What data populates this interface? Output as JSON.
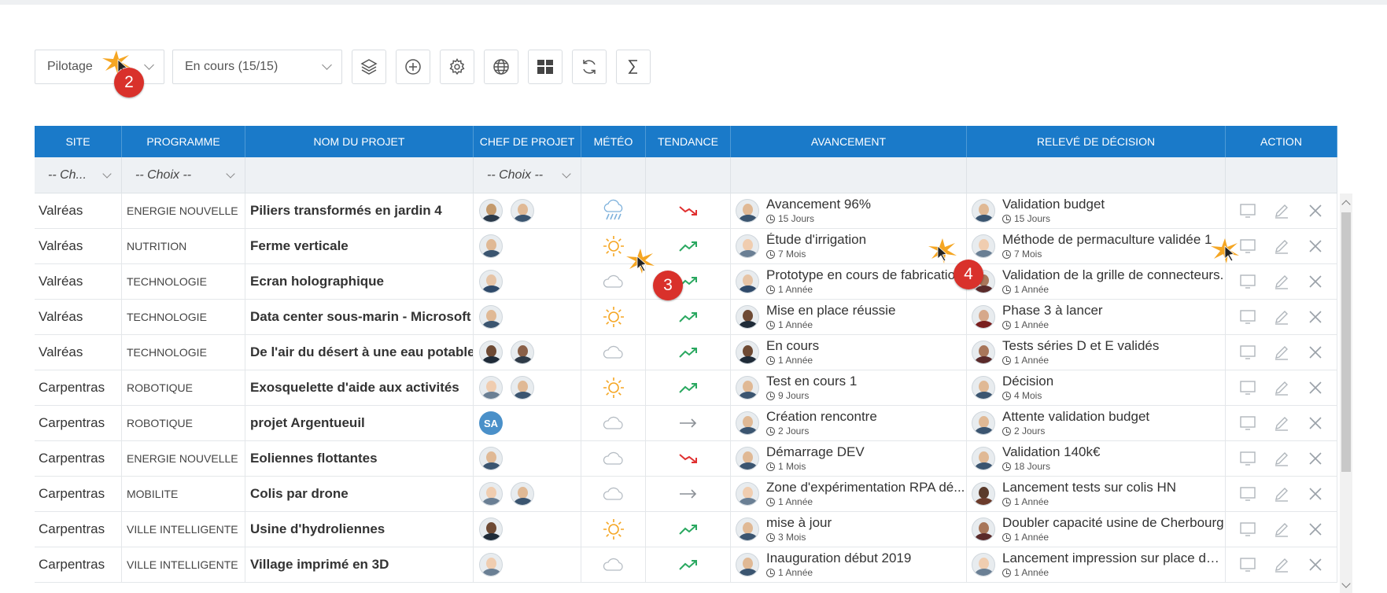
{
  "toolbar": {
    "view_select": "Pilotage",
    "status_select": "En cours (15/15)",
    "buttons": [
      "layers-icon",
      "add-icon",
      "settings-icon",
      "globe-icon",
      "dashboard-icon",
      "refresh-icon",
      "sum-icon"
    ]
  },
  "annotations": [
    "2",
    "3",
    "4"
  ],
  "columns": {
    "site": "SITE",
    "programme": "PROGRAMME",
    "nom": "NOM DU PROJET",
    "chef": "CHEF DE PROJET",
    "meteo": "MÉTÉO",
    "tendance": "TENDANCE",
    "avancement": "AVANCEMENT",
    "releve": "RELEVÉ DE DÉCISION",
    "action": "ACTION"
  },
  "filters": {
    "site": "-- Ch...",
    "programme": "-- Choix --",
    "chef": "-- Choix --"
  },
  "colors": {
    "header": "#1a7ac9",
    "badge": "#d9312b",
    "sun": "#f5a623",
    "up": "#2aa860",
    "down": "#e03030"
  },
  "rows": [
    {
      "site": "Valréas",
      "programme": "ENERGIE NOUVELLE",
      "nom": "Piliers transformés en jardin 4",
      "chefs": [
        "a",
        "b"
      ],
      "meteo": "rain",
      "tendance": "down",
      "av_text": "Avancement 96%",
      "av_date": "15 Jours",
      "av_av": "b",
      "rel_text": "Validation budget",
      "rel_date": "15 Jours",
      "rel_av": "b"
    },
    {
      "site": "Valréas",
      "programme": "NUTRITION",
      "nom": "Ferme verticale",
      "chefs": [
        "b"
      ],
      "meteo": "sun",
      "tendance": "up",
      "av_text": "Étude d'irrigation",
      "av_date": "7 Mois",
      "av_av": "c",
      "rel_text": "Méthode de permaculture validée 1",
      "rel_date": "7 Mois",
      "rel_av": "c"
    },
    {
      "site": "Valréas",
      "programme": "TECHNOLOGIE",
      "nom": "Ecran holographique",
      "chefs": [
        "d"
      ],
      "meteo": "cloud",
      "tendance": "up",
      "av_text": "Prototype en cours de fabrication",
      "av_date": "1 Année",
      "av_av": "d",
      "rel_text": "Validation de la grille de connecteurs.",
      "rel_date": "1 Année",
      "rel_av": "e"
    },
    {
      "site": "Valréas",
      "programme": "TECHNOLOGIE",
      "nom": "Data center sous-marin - Microsoft",
      "chefs": [
        "b"
      ],
      "meteo": "sun",
      "tendance": "up",
      "av_text": "Mise en place réussie",
      "av_date": "1 Année",
      "av_av": "f",
      "rel_text": "Phase 3 à lancer",
      "rel_date": "1 Année",
      "rel_av": "g"
    },
    {
      "site": "Valréas",
      "programme": "TECHNOLOGIE",
      "nom": "De l'air du désert à une eau potable",
      "chefs": [
        "f",
        "h"
      ],
      "meteo": "cloud",
      "tendance": "up",
      "av_text": "En cours",
      "av_date": "1 Année",
      "av_av": "f",
      "rel_text": "Tests séries D et E validés",
      "rel_date": "1 Année",
      "rel_av": "e"
    },
    {
      "site": "Carpentras",
      "programme": "ROBOTIQUE",
      "nom": "Exosquelette d'aide aux activités",
      "chefs": [
        "c",
        "b"
      ],
      "meteo": "sun",
      "tendance": "up",
      "av_text": "Test en cours 1",
      "av_date": "9 Jours",
      "av_av": "b",
      "rel_text": "Décision",
      "rel_date": "4 Mois",
      "rel_av": "b"
    },
    {
      "site": "Carpentras",
      "programme": "ROBOTIQUE",
      "nom": "projet Argentueuil",
      "chefs": [
        "SA"
      ],
      "meteo": "cloud",
      "tendance": "flat",
      "av_text": "Création rencontre",
      "av_date": "2 Jours",
      "av_av": "b",
      "rel_text": "Attente validation budget",
      "rel_date": "2 Jours",
      "rel_av": "b"
    },
    {
      "site": "Carpentras",
      "programme": "ENERGIE NOUVELLE",
      "nom": "Eoliennes flottantes",
      "chefs": [
        "b"
      ],
      "meteo": "cloud",
      "tendance": "down",
      "av_text": "Démarrage DEV",
      "av_date": "1 Mois",
      "av_av": "b",
      "rel_text": "Validation 140k€",
      "rel_date": "18 Jours",
      "rel_av": "b"
    },
    {
      "site": "Carpentras",
      "programme": "MOBILITE",
      "nom": "Colis par drone",
      "chefs": [
        "c",
        "b"
      ],
      "meteo": "cloud",
      "tendance": "flat",
      "av_text": "Zone d'expérimentation RPA dé...",
      "av_date": "1 Année",
      "av_av": "c",
      "rel_text": "Lancement tests sur colis HN",
      "rel_date": "1 Année",
      "rel_av": "i"
    },
    {
      "site": "Carpentras",
      "programme": "VILLE INTELLIGENTE",
      "nom": "Usine d'hydroliennes",
      "chefs": [
        "f"
      ],
      "meteo": "sun",
      "tendance": "up",
      "av_text": "mise à jour",
      "av_date": "3 Mois",
      "av_av": "b",
      "rel_text": "Doubler capacité usine de Cherbourg",
      "rel_date": "1 Année",
      "rel_av": "e"
    },
    {
      "site": "Carpentras",
      "programme": "VILLE INTELLIGENTE",
      "nom": "Village imprimé en 3D",
      "chefs": [
        "c"
      ],
      "meteo": "cloud",
      "tendance": "up",
      "av_text": "Inauguration début 2019",
      "av_date": "1 Année",
      "av_av": "b",
      "rel_text": "Lancement impression sur place de ...",
      "rel_date": "1 Année",
      "rel_av": "c"
    }
  ]
}
